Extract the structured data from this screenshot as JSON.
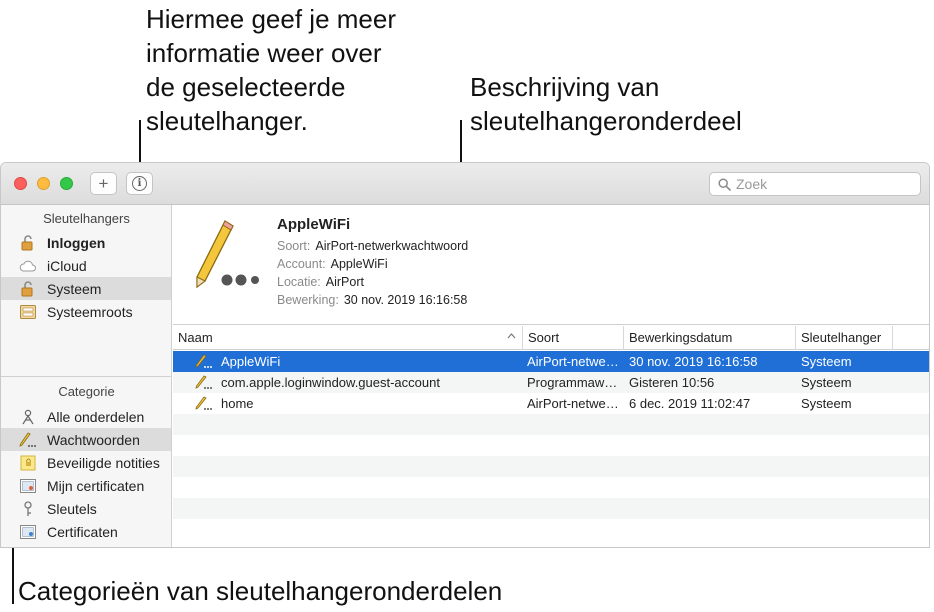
{
  "callouts": {
    "info": [
      "Hiermee geef je meer",
      "informatie weer over",
      "de geselecteerde",
      "sleutelhanger."
    ],
    "description": [
      "Beschrijving van",
      "sleutelhangeronderdeel"
    ],
    "categories": "Categorieën van sleutelhangeronderdelen"
  },
  "toolbar": {
    "add_label": "+",
    "info_label": "i",
    "search_placeholder": "Zoek"
  },
  "sidebar": {
    "keychains_header": "Sleutelhangers",
    "keychains": [
      {
        "label": "Inloggen",
        "icon": "lock-open-icon"
      },
      {
        "label": "iCloud",
        "icon": "cloud-icon"
      },
      {
        "label": "Systeem",
        "icon": "lock-icon"
      },
      {
        "label": "Systeemroots",
        "icon": "cabinet-icon"
      }
    ],
    "category_header": "Categorie",
    "categories": [
      {
        "label": "Alle onderdelen",
        "icon": "people-icon"
      },
      {
        "label": "Wachtwoorden",
        "icon": "pencil-icon"
      },
      {
        "label": "Beveiligde notities",
        "icon": "note-icon"
      },
      {
        "label": "Mijn certificaten",
        "icon": "certificate-icon"
      },
      {
        "label": "Sleutels",
        "icon": "key-icon"
      },
      {
        "label": "Certificaten",
        "icon": "certificate-icon"
      }
    ]
  },
  "detail": {
    "title": "AppleWiFi",
    "rows": [
      {
        "label": "Soort:",
        "value": "AirPort-netwerkwachtwoord"
      },
      {
        "label": "Account:",
        "value": "AppleWiFi"
      },
      {
        "label": "Locatie:",
        "value": "AirPort"
      },
      {
        "label": "Bewerking:",
        "value": "30 nov. 2019 16:16:58"
      }
    ]
  },
  "table": {
    "columns": [
      "Naam",
      "Soort",
      "Bewerkingsdatum",
      "Sleutelhanger"
    ],
    "rows": [
      {
        "name": "AppleWiFi",
        "kind": "AirPort-netwe…",
        "date": "30 nov. 2019 16:16:58",
        "keychain": "Systeem"
      },
      {
        "name": "com.apple.loginwindow.guest-account",
        "kind": "Programmaw…",
        "date": "Gisteren 10:56",
        "keychain": "Systeem"
      },
      {
        "name": "home",
        "kind": "AirPort-netwe…",
        "date": "6 dec. 2019 11:02:47",
        "keychain": "Systeem"
      }
    ]
  },
  "colors": {
    "selection": "#1f6fd6",
    "sidebar_selection": "#dcdcdc"
  }
}
